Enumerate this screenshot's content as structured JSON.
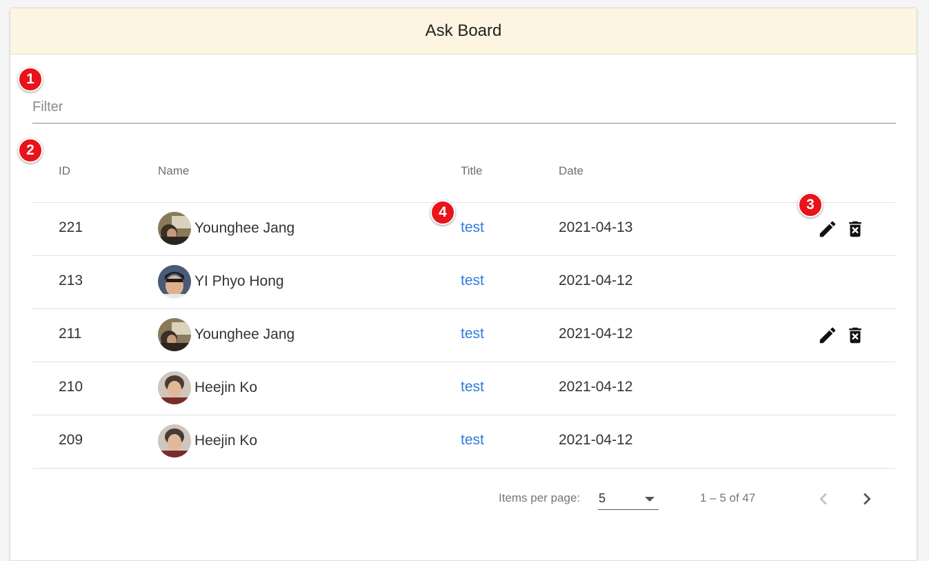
{
  "header": {
    "title": "Ask Board"
  },
  "markers": [
    "1",
    "2",
    "3",
    "4"
  ],
  "filter": {
    "placeholder": "Filter",
    "value": ""
  },
  "table": {
    "columns": {
      "id": "ID",
      "name": "Name",
      "title": "Title",
      "date": "Date"
    },
    "rows": [
      {
        "id": "221",
        "name": "Younghee Jang",
        "title": "test",
        "date": "2021-04-13",
        "avatar": "avatar-younghee",
        "editable": true
      },
      {
        "id": "213",
        "name": "YI Phyo Hong",
        "title": "test",
        "date": "2021-04-12",
        "avatar": "avatar-yiphyo",
        "editable": false
      },
      {
        "id": "211",
        "name": "Younghee Jang",
        "title": "test",
        "date": "2021-04-12",
        "avatar": "avatar-younghee",
        "editable": true
      },
      {
        "id": "210",
        "name": "Heejin Ko",
        "title": "test",
        "date": "2021-04-12",
        "avatar": "avatar-heejin",
        "editable": false
      },
      {
        "id": "209",
        "name": "Heejin Ko",
        "title": "test",
        "date": "2021-04-12",
        "avatar": "avatar-heejin",
        "editable": false
      }
    ]
  },
  "paginator": {
    "items_per_page_label": "Items per page:",
    "page_size": "5",
    "range_label": "1 – 5 of 47"
  },
  "colors": {
    "header_bg": "#fdf5e1",
    "link": "#2f7bdb",
    "marker": "#e8131b"
  }
}
